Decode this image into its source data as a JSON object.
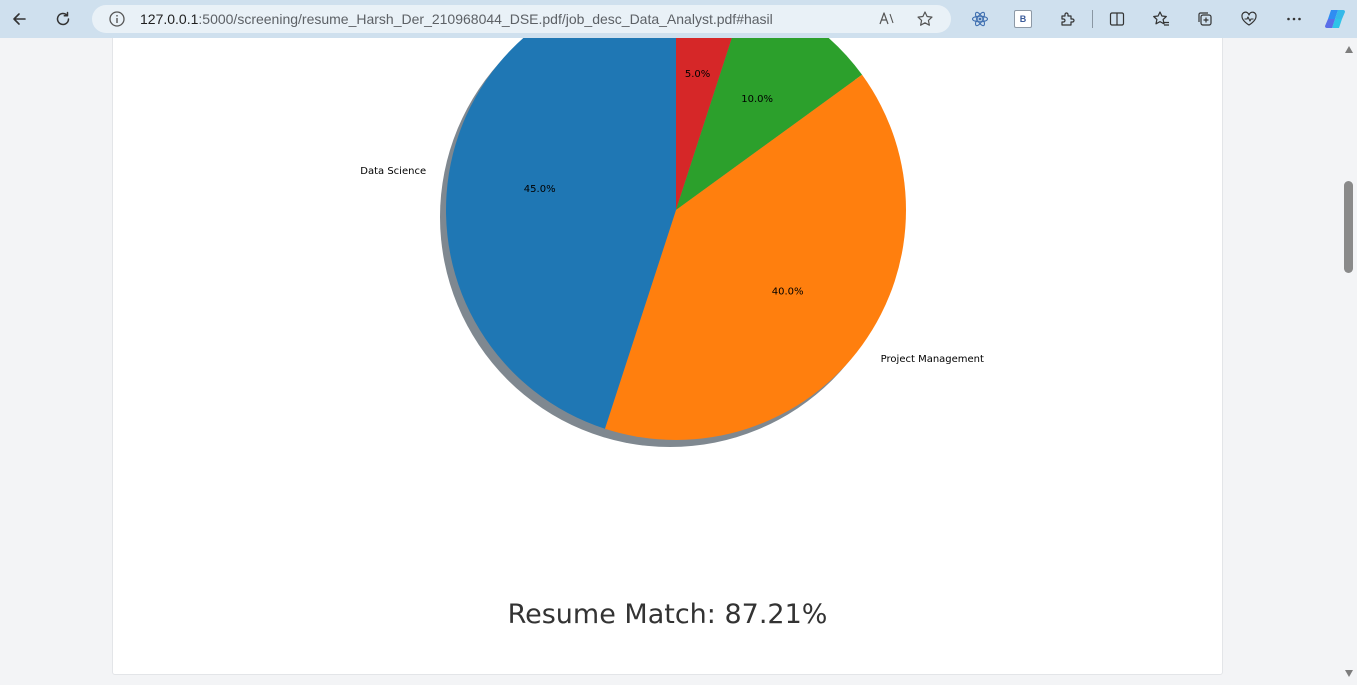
{
  "browser": {
    "url_host": "127.0.0.1",
    "url_path": ":5000/screening/resume_Harsh_Der_210968044_DSE.pdf/job_desc_Data_Analyst.pdf#hasil",
    "extension_badge": "B",
    "icons": [
      "back-icon",
      "refresh-icon",
      "site-info-icon",
      "read-aloud-icon",
      "favorite-star-icon",
      "react-devtools-icon",
      "extensions-icon",
      "split-screen-icon",
      "favorites-icon",
      "collections-icon",
      "browser-essentials-icon",
      "more-icon",
      "copilot-icon"
    ]
  },
  "chart_data": {
    "type": "pie",
    "title": "",
    "startangle": 90,
    "direction": "clockwise",
    "shadow": true,
    "slices": [
      {
        "label": "",
        "value": 5.0,
        "pct_label": "5.0%",
        "color": "#d62728"
      },
      {
        "label": "",
        "value": 10.0,
        "pct_label": "10.0%",
        "color": "#2ca02c"
      },
      {
        "label": "Project Management",
        "value": 40.0,
        "pct_label": "40.0%",
        "color": "#ff7f0e"
      },
      {
        "label": "Data Science",
        "value": 45.0,
        "pct_label": "45.0%",
        "color": "#1f77b4"
      }
    ]
  },
  "result": {
    "match_text": "Resume Match: 87.21%"
  }
}
